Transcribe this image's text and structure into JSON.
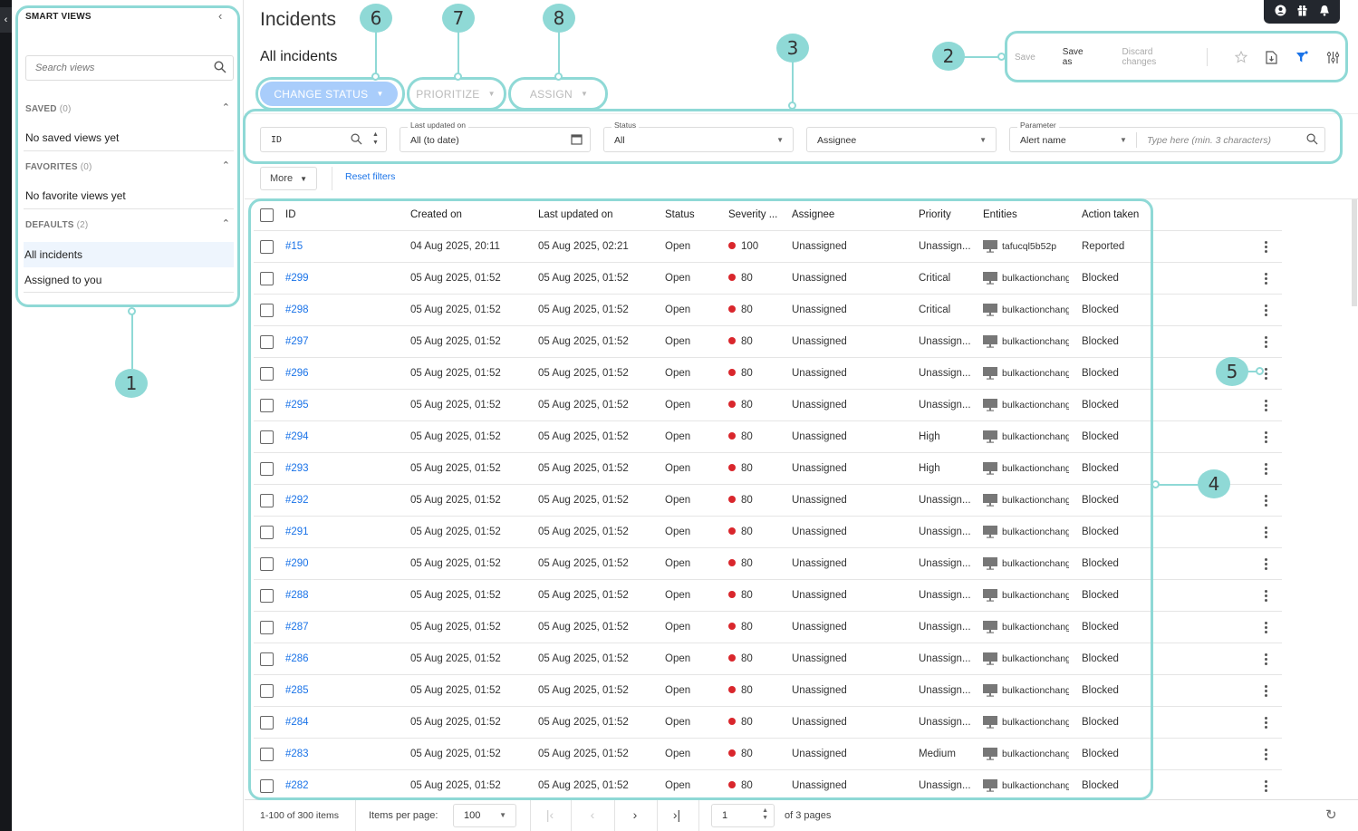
{
  "smart_views": {
    "title": "SMART VIEWS",
    "search_placeholder": "Search views",
    "sections": [
      {
        "label": "SAVED",
        "count": "(0)",
        "empty_text": "No saved views yet"
      },
      {
        "label": "FAVORITES",
        "count": "(0)",
        "empty_text": "No favorite views yet"
      },
      {
        "label": "DEFAULTS",
        "count": "(2)",
        "items": [
          "All incidents",
          "Assigned to you"
        ]
      }
    ],
    "active_item": "All incidents"
  },
  "header": {
    "page_title": "Incidents",
    "view_title": "All incidents",
    "topbar_icons": [
      "user-icon",
      "gift-icon",
      "bell-icon"
    ]
  },
  "view_actions": {
    "save": "Save",
    "save_as": "Save as",
    "discard": "Discard changes",
    "icons": [
      "star-icon",
      "export-file-icon",
      "filter-icon",
      "column-settings-icon"
    ],
    "filter_color": "#1a73e8"
  },
  "bulk_actions": {
    "change_status": "CHANGE STATUS",
    "prioritize": "PRIORITIZE",
    "assign": "ASSIGN"
  },
  "filters": {
    "id": {
      "placeholder": "ID"
    },
    "last_updated": {
      "label": "Last updated on",
      "value": "All (to date)"
    },
    "status": {
      "label": "Status",
      "value": "All"
    },
    "assignee": {
      "value": "Assignee"
    },
    "parameter": {
      "label": "Parameter",
      "value": "Alert name",
      "placeholder": "Type here (min. 3 characters)"
    },
    "more": "More",
    "reset": "Reset filters"
  },
  "table": {
    "columns": [
      "ID",
      "Created on",
      "Last updated on",
      "Status",
      "Severity ...",
      "Assignee",
      "Priority",
      "Entities",
      "Action taken"
    ],
    "rows": [
      {
        "id": "#15",
        "created": "04 Aug 2025, 20:11",
        "updated": "05 Aug 2025, 02:21",
        "status": "Open",
        "severity": "100",
        "assignee": "Unassigned",
        "priority": "Unassign...",
        "entity": "tafucql5b52p",
        "action": "Reported"
      },
      {
        "id": "#299",
        "created": "05 Aug 2025, 01:52",
        "updated": "05 Aug 2025, 01:52",
        "status": "Open",
        "severity": "80",
        "assignee": "Unassigned",
        "priority": "Critical",
        "entity": "bulkactionchang",
        "action": "Blocked"
      },
      {
        "id": "#298",
        "created": "05 Aug 2025, 01:52",
        "updated": "05 Aug 2025, 01:52",
        "status": "Open",
        "severity": "80",
        "assignee": "Unassigned",
        "priority": "Critical",
        "entity": "bulkactionchang",
        "action": "Blocked"
      },
      {
        "id": "#297",
        "created": "05 Aug 2025, 01:52",
        "updated": "05 Aug 2025, 01:52",
        "status": "Open",
        "severity": "80",
        "assignee": "Unassigned",
        "priority": "Unassign...",
        "entity": "bulkactionchang",
        "action": "Blocked"
      },
      {
        "id": "#296",
        "created": "05 Aug 2025, 01:52",
        "updated": "05 Aug 2025, 01:52",
        "status": "Open",
        "severity": "80",
        "assignee": "Unassigned",
        "priority": "Unassign...",
        "entity": "bulkactionchang",
        "action": "Blocked"
      },
      {
        "id": "#295",
        "created": "05 Aug 2025, 01:52",
        "updated": "05 Aug 2025, 01:52",
        "status": "Open",
        "severity": "80",
        "assignee": "Unassigned",
        "priority": "Unassign...",
        "entity": "bulkactionchang",
        "action": "Blocked"
      },
      {
        "id": "#294",
        "created": "05 Aug 2025, 01:52",
        "updated": "05 Aug 2025, 01:52",
        "status": "Open",
        "severity": "80",
        "assignee": "Unassigned",
        "priority": "High",
        "entity": "bulkactionchang",
        "action": "Blocked"
      },
      {
        "id": "#293",
        "created": "05 Aug 2025, 01:52",
        "updated": "05 Aug 2025, 01:52",
        "status": "Open",
        "severity": "80",
        "assignee": "Unassigned",
        "priority": "High",
        "entity": "bulkactionchang",
        "action": "Blocked"
      },
      {
        "id": "#292",
        "created": "05 Aug 2025, 01:52",
        "updated": "05 Aug 2025, 01:52",
        "status": "Open",
        "severity": "80",
        "assignee": "Unassigned",
        "priority": "Unassign...",
        "entity": "bulkactionchang",
        "action": "Blocked"
      },
      {
        "id": "#291",
        "created": "05 Aug 2025, 01:52",
        "updated": "05 Aug 2025, 01:52",
        "status": "Open",
        "severity": "80",
        "assignee": "Unassigned",
        "priority": "Unassign...",
        "entity": "bulkactionchang",
        "action": "Blocked"
      },
      {
        "id": "#290",
        "created": "05 Aug 2025, 01:52",
        "updated": "05 Aug 2025, 01:52",
        "status": "Open",
        "severity": "80",
        "assignee": "Unassigned",
        "priority": "Unassign...",
        "entity": "bulkactionchang",
        "action": "Blocked"
      },
      {
        "id": "#288",
        "created": "05 Aug 2025, 01:52",
        "updated": "05 Aug 2025, 01:52",
        "status": "Open",
        "severity": "80",
        "assignee": "Unassigned",
        "priority": "Unassign...",
        "entity": "bulkactionchang",
        "action": "Blocked"
      },
      {
        "id": "#287",
        "created": "05 Aug 2025, 01:52",
        "updated": "05 Aug 2025, 01:52",
        "status": "Open",
        "severity": "80",
        "assignee": "Unassigned",
        "priority": "Unassign...",
        "entity": "bulkactionchang",
        "action": "Blocked"
      },
      {
        "id": "#286",
        "created": "05 Aug 2025, 01:52",
        "updated": "05 Aug 2025, 01:52",
        "status": "Open",
        "severity": "80",
        "assignee": "Unassigned",
        "priority": "Unassign...",
        "entity": "bulkactionchang",
        "action": "Blocked"
      },
      {
        "id": "#285",
        "created": "05 Aug 2025, 01:52",
        "updated": "05 Aug 2025, 01:52",
        "status": "Open",
        "severity": "80",
        "assignee": "Unassigned",
        "priority": "Unassign...",
        "entity": "bulkactionchang",
        "action": "Blocked"
      },
      {
        "id": "#284",
        "created": "05 Aug 2025, 01:52",
        "updated": "05 Aug 2025, 01:52",
        "status": "Open",
        "severity": "80",
        "assignee": "Unassigned",
        "priority": "Unassign...",
        "entity": "bulkactionchang",
        "action": "Blocked"
      },
      {
        "id": "#283",
        "created": "05 Aug 2025, 01:52",
        "updated": "05 Aug 2025, 01:52",
        "status": "Open",
        "severity": "80",
        "assignee": "Unassigned",
        "priority": "Medium",
        "entity": "bulkactionchang",
        "action": "Blocked"
      },
      {
        "id": "#282",
        "created": "05 Aug 2025, 01:52",
        "updated": "05 Aug 2025, 01:52",
        "status": "Open",
        "severity": "80",
        "assignee": "Unassigned",
        "priority": "Unassign...",
        "entity": "bulkactionchang",
        "action": "Blocked"
      }
    ],
    "severity_color": "#d9262c",
    "link_color": "#1a73e8"
  },
  "pagination": {
    "count": "1-100 of 300 items",
    "items_per_page_label": "Items per page:",
    "items_per_page": "100",
    "page": "1",
    "of_pages": "of 3 pages"
  },
  "annotations": [
    "1",
    "2",
    "3",
    "4",
    "5",
    "6",
    "7",
    "8"
  ],
  "annotation_color": "#8fd9d6"
}
